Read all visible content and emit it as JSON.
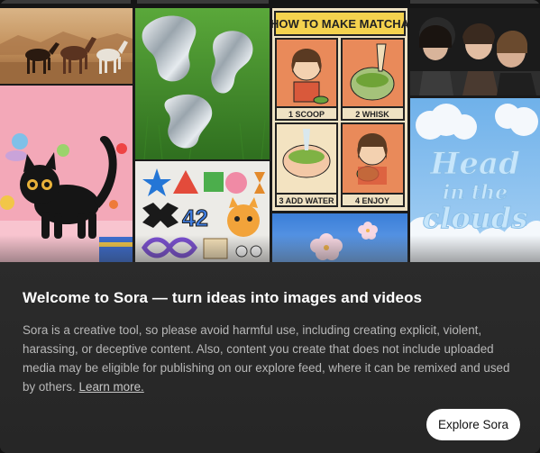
{
  "dialog": {
    "title": "Welcome to Sora — turn ideas into images and videos",
    "body_text": "Sora is a creative tool, so please avoid harmful use, including creating explicit, violent, harassing, or deceptive content. Also, content you create that does not include uploaded media may be eligible for publishing on our explore feed, where it can be remixed and used by others.",
    "learn_more_label": "Learn more.",
    "explore_button_label": "Explore Sora"
  },
  "gallery": {
    "matcha_comic": {
      "heading": "HOW TO MAKE MATCHA",
      "panels": [
        "1 SCOOP",
        "2 WHISK",
        "3 ADD WATER",
        "4 ENJOY"
      ]
    },
    "sticker_number": "42",
    "cloud_text": [
      "Head",
      "in the",
      "clouds"
    ]
  }
}
